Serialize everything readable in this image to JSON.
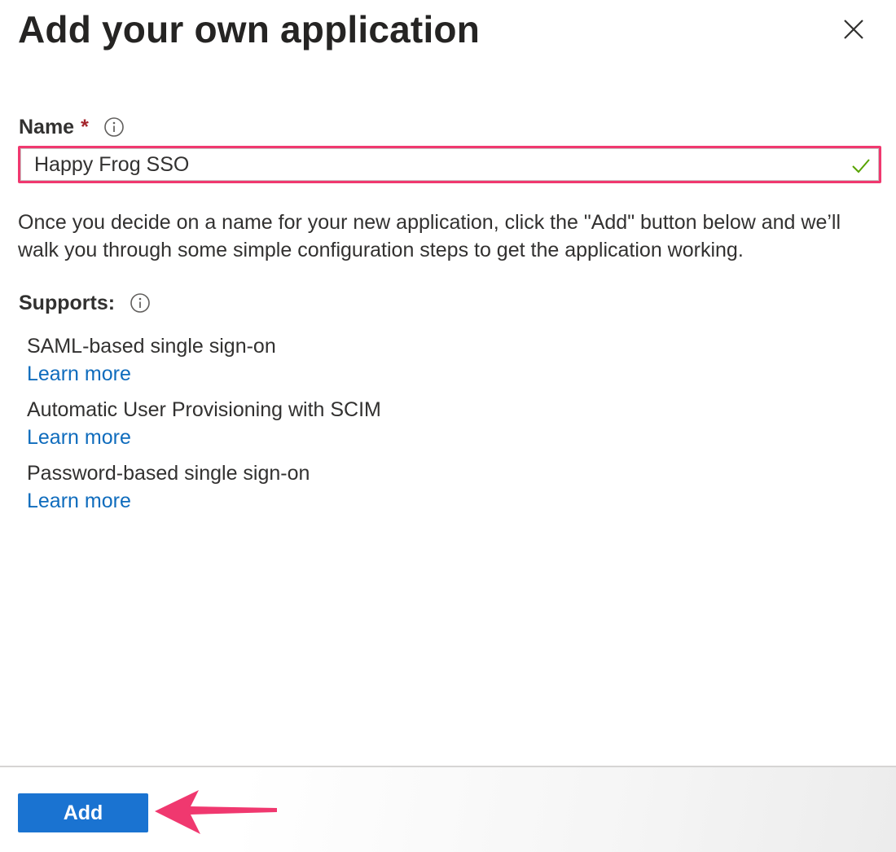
{
  "dialog": {
    "title": "Add your own application"
  },
  "name_field": {
    "label": "Name",
    "required_marker": "*",
    "value": "Happy Frog SSO"
  },
  "description": "Once you decide on a name for your new application, click the \"Add\" button below and we’ll walk you through some simple configuration steps to get the application working.",
  "supports": {
    "label": "Supports:",
    "items": [
      {
        "name": "SAML-based single sign-on",
        "link": "Learn more"
      },
      {
        "name": "Automatic User Provisioning with SCIM",
        "link": "Learn more"
      },
      {
        "name": "Password-based single sign-on",
        "link": "Learn more"
      }
    ]
  },
  "footer": {
    "add_label": "Add"
  },
  "icons": {
    "close": "close-icon",
    "info": "info-icon",
    "valid": "checkmark-icon",
    "annotation": "arrow-icon"
  },
  "colors": {
    "highlight_border": "#f0386f",
    "primary_button": "#1a73d1",
    "link": "#0f6cbd",
    "required": "#a4262c",
    "valid_check": "#57a300",
    "annotation_arrow": "#f0386f"
  }
}
